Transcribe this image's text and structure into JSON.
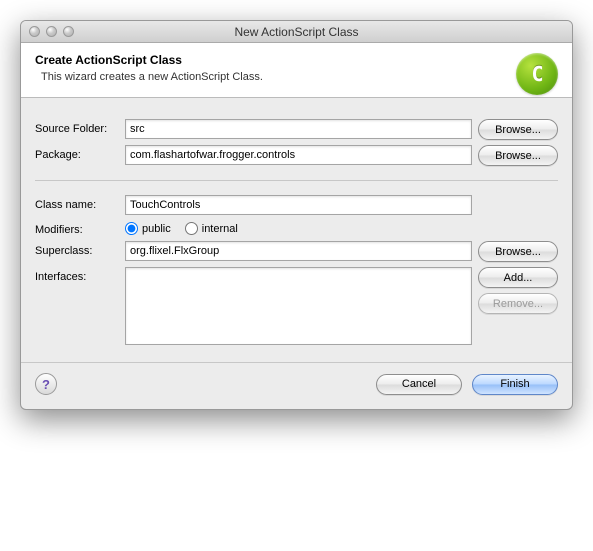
{
  "window": {
    "title": "New ActionScript Class"
  },
  "banner": {
    "heading": "Create ActionScript Class",
    "description": "This wizard creates a new ActionScript Class.",
    "icon_letter": "C"
  },
  "labels": {
    "sourceFolder": "Source Folder:",
    "package": "Package:",
    "className": "Class name:",
    "modifiers": "Modifiers:",
    "superclass": "Superclass:",
    "interfaces": "Interfaces:"
  },
  "fields": {
    "sourceFolder": "src",
    "package": "com.flashartofwar.frogger.controls",
    "className": "TouchControls",
    "superclass": "org.flixel.FlxGroup",
    "interfaces": ""
  },
  "modifiers": {
    "public": "public",
    "internal": "internal",
    "selected": "public"
  },
  "buttons": {
    "browse": "Browse...",
    "add": "Add...",
    "remove": "Remove...",
    "cancel": "Cancel",
    "finish": "Finish",
    "help": "?"
  }
}
